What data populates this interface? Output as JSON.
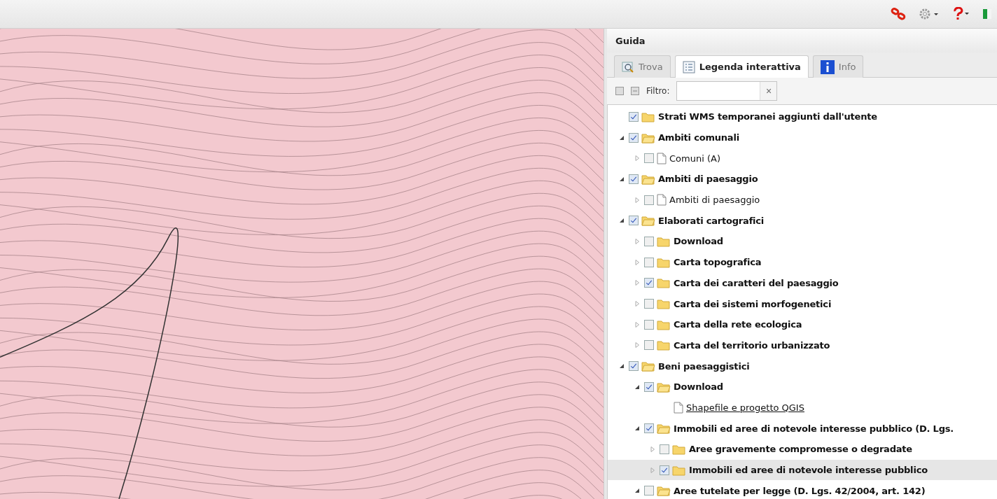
{
  "panel": {
    "title": "Guida"
  },
  "tabs": [
    {
      "label": "Trova",
      "kind": "search",
      "selected": false
    },
    {
      "label": "Legenda interattiva",
      "kind": "legend",
      "selected": true
    },
    {
      "label": "Info",
      "kind": "info",
      "selected": false
    }
  ],
  "filter": {
    "label": "Filtro:",
    "clear": "×"
  },
  "tree": [
    {
      "label": "Strati WMS temporanei aggiunti dall'utente",
      "kind": "folder",
      "checked": true,
      "selected": false
    },
    {
      "label": "Ambiti comunali",
      "kind": "folder",
      "checked": true,
      "expanded": true,
      "selected": false,
      "children": [
        {
          "label": "Comuni (A)",
          "kind": "layer",
          "checked": false,
          "expanded": false,
          "selected": false
        }
      ]
    },
    {
      "label": "Ambiti di paesaggio",
      "kind": "folder",
      "checked": true,
      "expanded": true,
      "selected": false,
      "children": [
        {
          "label": "Ambiti di paesaggio",
          "kind": "layer",
          "checked": false,
          "expanded": false,
          "selected": false
        }
      ]
    },
    {
      "label": "Elaborati cartografici",
      "kind": "folder",
      "checked": true,
      "expanded": true,
      "selected": false,
      "children": [
        {
          "label": "Download",
          "kind": "folder",
          "checked": false,
          "expanded": false,
          "selected": false
        },
        {
          "label": "Carta topografica",
          "kind": "folder",
          "checked": false,
          "expanded": false,
          "selected": false
        },
        {
          "label": "Carta dei caratteri del paesaggio",
          "kind": "folder",
          "checked": true,
          "expanded": false,
          "selected": false
        },
        {
          "label": "Carta dei sistemi morfogenetici",
          "kind": "folder",
          "checked": false,
          "expanded": false,
          "selected": false
        },
        {
          "label": "Carta della rete ecologica",
          "kind": "folder",
          "checked": false,
          "expanded": false,
          "selected": false
        },
        {
          "label": "Carta del territorio urbanizzato",
          "kind": "folder",
          "checked": false,
          "expanded": false,
          "selected": false
        }
      ]
    },
    {
      "label": "Beni paesaggistici",
      "kind": "folder",
      "checked": true,
      "expanded": true,
      "selected": false,
      "children": [
        {
          "label": "Download",
          "kind": "folder",
          "checked": true,
          "expanded": true,
          "selected": false,
          "children": [
            {
              "label": "Shapefile e progetto QGIS",
              "kind": "link",
              "selected": false
            }
          ]
        },
        {
          "label": "Immobili ed aree di notevole interesse pubblico (D. Lgs.",
          "kind": "folder",
          "checked": true,
          "expanded": true,
          "selected": false,
          "children": [
            {
              "label": "Aree gravemente compromesse o degradate",
              "kind": "folder",
              "checked": false,
              "expanded": false,
              "selected": false
            },
            {
              "label": "Immobili ed aree di notevole interesse pubblico",
              "kind": "folder",
              "checked": true,
              "expanded": false,
              "selected": true
            }
          ]
        },
        {
          "label": "Aree tutelate per legge (D. Lgs. 42/2004, art. 142)",
          "kind": "folder",
          "checked": false,
          "expanded": true,
          "selected": false
        }
      ]
    }
  ]
}
